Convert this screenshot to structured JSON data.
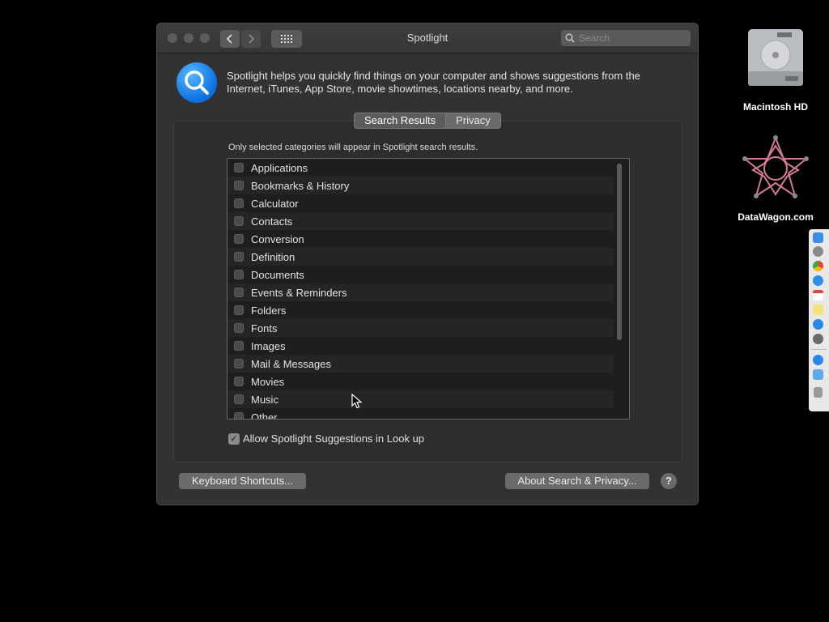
{
  "window": {
    "title": "Spotlight",
    "search_placeholder": "Search"
  },
  "description": "Spotlight helps you quickly find things on your computer and shows suggestions from the Internet, iTunes, App Store, movie showtimes, locations nearby, and more.",
  "tabs": [
    {
      "label": "Search Results",
      "selected": true
    },
    {
      "label": "Privacy",
      "selected": false
    }
  ],
  "hint": "Only selected categories will appear in Spotlight search results.",
  "categories": [
    {
      "label": "Applications",
      "checked": false
    },
    {
      "label": "Bookmarks & History",
      "checked": false
    },
    {
      "label": "Calculator",
      "checked": false
    },
    {
      "label": "Contacts",
      "checked": false
    },
    {
      "label": "Conversion",
      "checked": false
    },
    {
      "label": "Definition",
      "checked": false
    },
    {
      "label": "Documents",
      "checked": false
    },
    {
      "label": "Events & Reminders",
      "checked": false
    },
    {
      "label": "Folders",
      "checked": false
    },
    {
      "label": "Fonts",
      "checked": false
    },
    {
      "label": "Images",
      "checked": false
    },
    {
      "label": "Mail & Messages",
      "checked": false
    },
    {
      "label": "Movies",
      "checked": false
    },
    {
      "label": "Music",
      "checked": false
    },
    {
      "label": "Other",
      "checked": false
    }
  ],
  "allow_suggestions": {
    "label": "Allow Spotlight Suggestions in Look up",
    "checked": true
  },
  "buttons": {
    "keyboard_shortcuts": "Keyboard Shortcuts...",
    "about": "About Search & Privacy...",
    "help": "?"
  },
  "desktop": [
    {
      "label": "Macintosh HD",
      "icon": "hard-drive-icon"
    },
    {
      "label": "DataWagon.com",
      "icon": "geometric-star-icon"
    }
  ],
  "dock_items": [
    "finder-icon",
    "launchpad-icon",
    "chrome-icon",
    "safari-icon",
    "calendar-icon",
    "notes-icon",
    "app-store-icon",
    "system-preferences-icon",
    "app-store-icon",
    "folder-icon",
    "trash-icon"
  ],
  "colors": {
    "accent": "#0a84ff",
    "window_bg": "#323232",
    "desktop_bg": "#000000"
  }
}
